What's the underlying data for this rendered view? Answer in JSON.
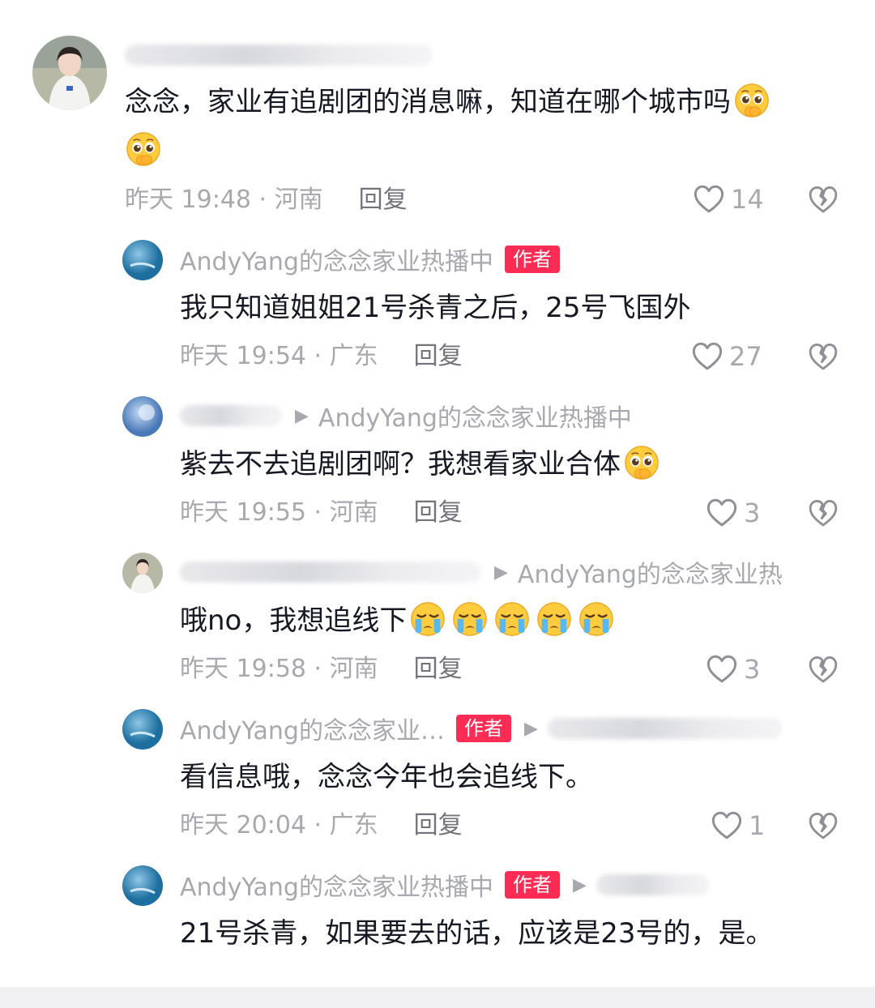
{
  "comments": [
    {
      "text": "念念，家业有追剧团的消息嘛，知道在哪个城市吗",
      "time_location": "昨天 19:48 · 河南",
      "reply_label": "回复",
      "likes": "14"
    },
    {
      "author": "AndyYang的念念家业热播中",
      "badge": "作者",
      "text": "我只知道姐姐21号杀青之后，25号飞国外",
      "time_location": "昨天 19:54 · 广东",
      "reply_label": "回复",
      "likes": "27"
    },
    {
      "reply_to": "AndyYang的念念家业热播中",
      "text": "紫去不去追剧团啊？我想看家业合体",
      "time_location": "昨天 19:55 · 河南",
      "reply_label": "回复",
      "likes": "3"
    },
    {
      "reply_to": "AndyYang的念念家业热",
      "text": "哦no，我想追线下",
      "time_location": "昨天 19:58 · 河南",
      "reply_label": "回复",
      "likes": "3"
    },
    {
      "author": "AndyYang的念念家业…",
      "badge": "作者",
      "text": "看信息哦，念念今年也会追线下。",
      "time_location": "昨天 20:04 · 广东",
      "reply_label": "回复",
      "likes": "1"
    },
    {
      "author": "AndyYang的念念家业热播中",
      "badge": "作者",
      "text": "21号杀青，如果要去的话，应该是23号的，是。"
    }
  ],
  "icons": {
    "like": "heart-outline-icon",
    "dislike": "broken-heart-icon",
    "emoji_pleading": "pleading-face-emoji",
    "emoji_crying": "crying-face-emoji",
    "arrow": "reply-arrow-icon"
  },
  "colors": {
    "badge": "#fe2c55",
    "meta_text": "#a8a9ae",
    "body_text": "#161823"
  }
}
